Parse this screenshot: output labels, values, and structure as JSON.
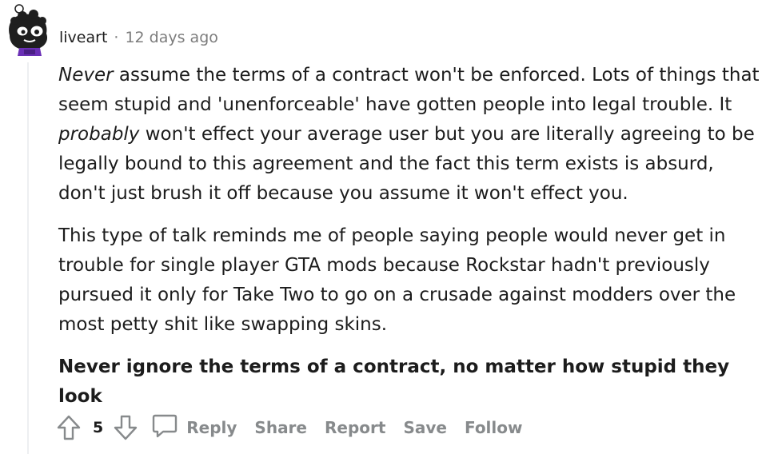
{
  "comment": {
    "author": "liveart",
    "separator": "·",
    "timestamp": "12 days ago",
    "paragraphs": {
      "p1": {
        "em1": "Never",
        "t1": " assume the terms of a contract won't be enforced. Lots of things that seem stupid and 'unenforceable' have gotten people into legal trouble. It ",
        "em2": "probably",
        "t2": " won't effect your average user but you are literally agreeing to be legally bound to this agreement and the fact this term exists is absurd, don't just brush it off because you assume it won't effect you."
      },
      "p2": "This type of talk reminds me of people saying people would never get in trouble for single player GTA mods because Rockstar hadn't previously pursued it only for Take Two to go on a crusade against modders over the most petty shit like swapping skins.",
      "p3": "Never ignore the terms of a contract, no matter how stupid they look"
    }
  },
  "actions": {
    "upvote_icon": "upvote-arrow-icon",
    "score": "5",
    "downvote_icon": "downvote-arrow-icon",
    "reply_icon": "speech-bubble-icon",
    "reply": "Reply",
    "share": "Share",
    "report": "Report",
    "save": "Save",
    "follow": "Follow"
  },
  "colors": {
    "text": "#1c1c1c",
    "meta": "#7c7c7c",
    "action": "#878a8c",
    "icon": "#878a8c",
    "avatar_accent": "#6a2fb5"
  }
}
